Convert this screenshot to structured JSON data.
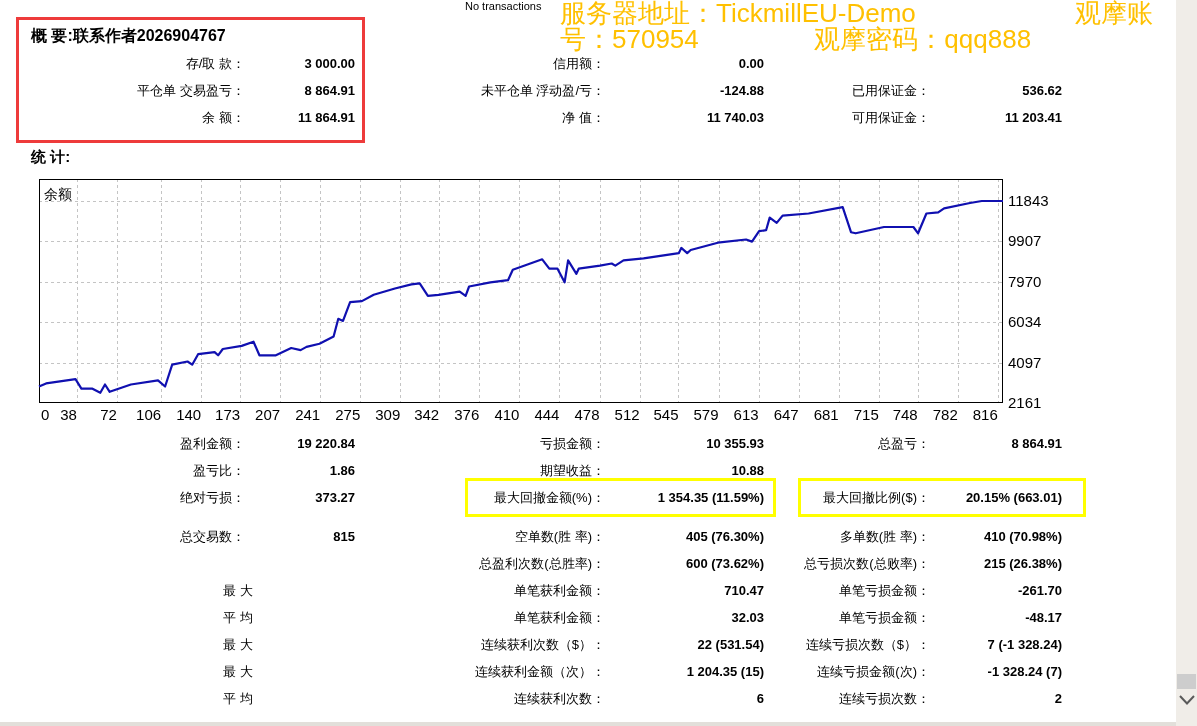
{
  "status_note": "No transactions",
  "annotation": "服务器地址：TickmillEU-Demo                      观摩账号：570954                观摩密码：qqq888",
  "summary": {
    "title": "概 要:联系作者2026904767",
    "highlighted": true,
    "rows": [
      {
        "left": {
          "label": "存/取 款：",
          "value": "3 000.00"
        },
        "middle": {
          "label": "信用额：",
          "value": "0.00"
        }
      },
      {
        "left": {
          "label": "平仓单 交易盈亏：",
          "value": "8 864.91"
        },
        "middle": {
          "label": "未平仓单 浮动盈/亏：",
          "value": "-124.88"
        },
        "right": {
          "label": "已用保证金：",
          "value": "536.62"
        }
      },
      {
        "left": {
          "label": "余 额：",
          "value": "11 864.91"
        },
        "middle": {
          "label": "净 值：",
          "value": "11 740.03"
        },
        "right": {
          "label": "可用保证金：",
          "value": "11 203.41"
        }
      }
    ]
  },
  "statistics": {
    "title": "统 计:",
    "chart": {
      "axis_start_label": "0",
      "chart_data": {
        "type": "line",
        "grid": true,
        "x": [
          13,
          19,
          44,
          49,
          58,
          65,
          69,
          73,
          91,
          114,
          120,
          126,
          139,
          143,
          148,
          162,
          165,
          169,
          185,
          195,
          200,
          214,
          227,
          235,
          240,
          251,
          263,
          267,
          271,
          277,
          287,
          297,
          315,
          329,
          336,
          343,
          352,
          370,
          375,
          378,
          396,
          411,
          415,
          440,
          446,
          453,
          459,
          462,
          469,
          471,
          489,
          499,
          502,
          509,
          526,
          556,
          558,
          563,
          566,
          589,
          613,
          618,
          624,
          630,
          633,
          639,
          644,
          666,
          695,
          702,
          706,
          730,
          755,
          759,
          766,
          776,
          781,
          803,
          813,
          831
        ],
        "series": [
          {
            "name": "余额",
            "color": "#1010b0",
            "values": [
              2950,
              3100,
              3300,
              2850,
              2850,
              2650,
              3050,
              2700,
              3050,
              3250,
              2950,
              4000,
              4150,
              4000,
              4500,
              4600,
              4450,
              4750,
              4900,
              5100,
              4450,
              4450,
              4800,
              4700,
              4850,
              5000,
              5350,
              6200,
              6100,
              7000,
              7050,
              7350,
              7650,
              7850,
              7900,
              7300,
              7350,
              7500,
              7300,
              7750,
              7950,
              8050,
              8550,
              9050,
              8600,
              8600,
              7950,
              9000,
              8350,
              8600,
              8750,
              8850,
              8750,
              9000,
              9100,
              9350,
              9600,
              9350,
              9500,
              9850,
              10000,
              9900,
              10400,
              10450,
              11050,
              10800,
              11150,
              11250,
              11550,
              10350,
              10300,
              10600,
              10600,
              10300,
              11250,
              11300,
              11500,
              11750,
              11850,
              11850
            ]
          }
        ],
        "xlim": [
          13,
          831
        ],
        "ylim": [
          2161,
          12903
        ],
        "xticks": [
          38,
          72,
          106,
          140,
          173,
          207,
          241,
          275,
          309,
          342,
          376,
          410,
          444,
          478,
          512,
          545,
          579,
          613,
          647,
          681,
          715,
          748,
          782,
          816
        ],
        "yticks": [
          2161,
          4097,
          6034,
          7970,
          9907,
          11843
        ]
      }
    },
    "rows": [
      {
        "left": {
          "label": "盈利金额：",
          "value": "19 220.84",
          "highlighted": false
        },
        "middle": {
          "label": "亏损金额：",
          "value": "10 355.93",
          "highlighted": false
        },
        "right": {
          "label": "总盈亏：",
          "value": "8 864.91",
          "highlighted": false
        }
      },
      {
        "left": {
          "label": "盈亏比：",
          "value": "1.86",
          "highlighted": false
        },
        "middle": {
          "label": "期望收益：",
          "value": "10.88",
          "highlighted": false
        }
      },
      {
        "left": {
          "label": "绝对亏损：",
          "value": "373.27",
          "highlighted": false
        },
        "middle": {
          "label": "最大回撤金额(%)：",
          "value": "1 354.35 (11.59%)",
          "highlighted": true
        },
        "right": {
          "label": "最大回撤比例($)：",
          "value": "20.15% (663.01)",
          "highlighted": true
        }
      },
      {
        "left": {
          "label": "总交易数：",
          "value": "815",
          "highlighted": false
        },
        "middle": {
          "label": "空单数(胜 率)：",
          "value": "405 (76.30%)",
          "highlighted": false
        },
        "right": {
          "label": "多单数(胜 率)：",
          "value": "410 (70.98%)",
          "highlighted": false
        }
      },
      {
        "middle": {
          "label": "总盈利次数(总胜率)：",
          "value": "600 (73.62%)",
          "highlighted": false
        },
        "right": {
          "label": "总亏损次数(总败率)：",
          "value": "215 (26.38%)",
          "highlighted": false
        }
      },
      {
        "left": {
          "label": "最 大",
          "highlighted": false
        },
        "middle": {
          "label": "单笔获利金额：",
          "value": "710.47",
          "highlighted": false
        },
        "right": {
          "label": "单笔亏损金额：",
          "value": "-261.70",
          "highlighted": false
        }
      },
      {
        "left": {
          "label": "平 均",
          "highlighted": false
        },
        "middle": {
          "label": "单笔获利金额：",
          "value": "32.03",
          "highlighted": false
        },
        "right": {
          "label": "单笔亏损金额：",
          "value": "-48.17",
          "highlighted": false
        }
      },
      {
        "left": {
          "label": "最 大",
          "highlighted": false
        },
        "middle": {
          "label": "连续获利次数（$）：",
          "value": "22 (531.54)",
          "highlighted": false
        },
        "right": {
          "label": "连续亏损次数（$）：",
          "value": "7 (-1 328.24)",
          "highlighted": false
        }
      },
      {
        "left": {
          "label": "最 大",
          "highlighted": false
        },
        "middle": {
          "label": "连续获利金额（次）：",
          "value": "1 204.35 (15)",
          "highlighted": false
        },
        "right": {
          "label": "连续亏损金额(次)：",
          "value": "-1 328.24 (7)",
          "highlighted": false
        }
      },
      {
        "left": {
          "label": "平 均",
          "highlighted": false
        },
        "middle": {
          "label": "连续获利次数：",
          "value": "6",
          "highlighted": false
        },
        "right": {
          "label": "连续亏损次数：",
          "value": "2",
          "highlighted": false
        }
      }
    ]
  }
}
